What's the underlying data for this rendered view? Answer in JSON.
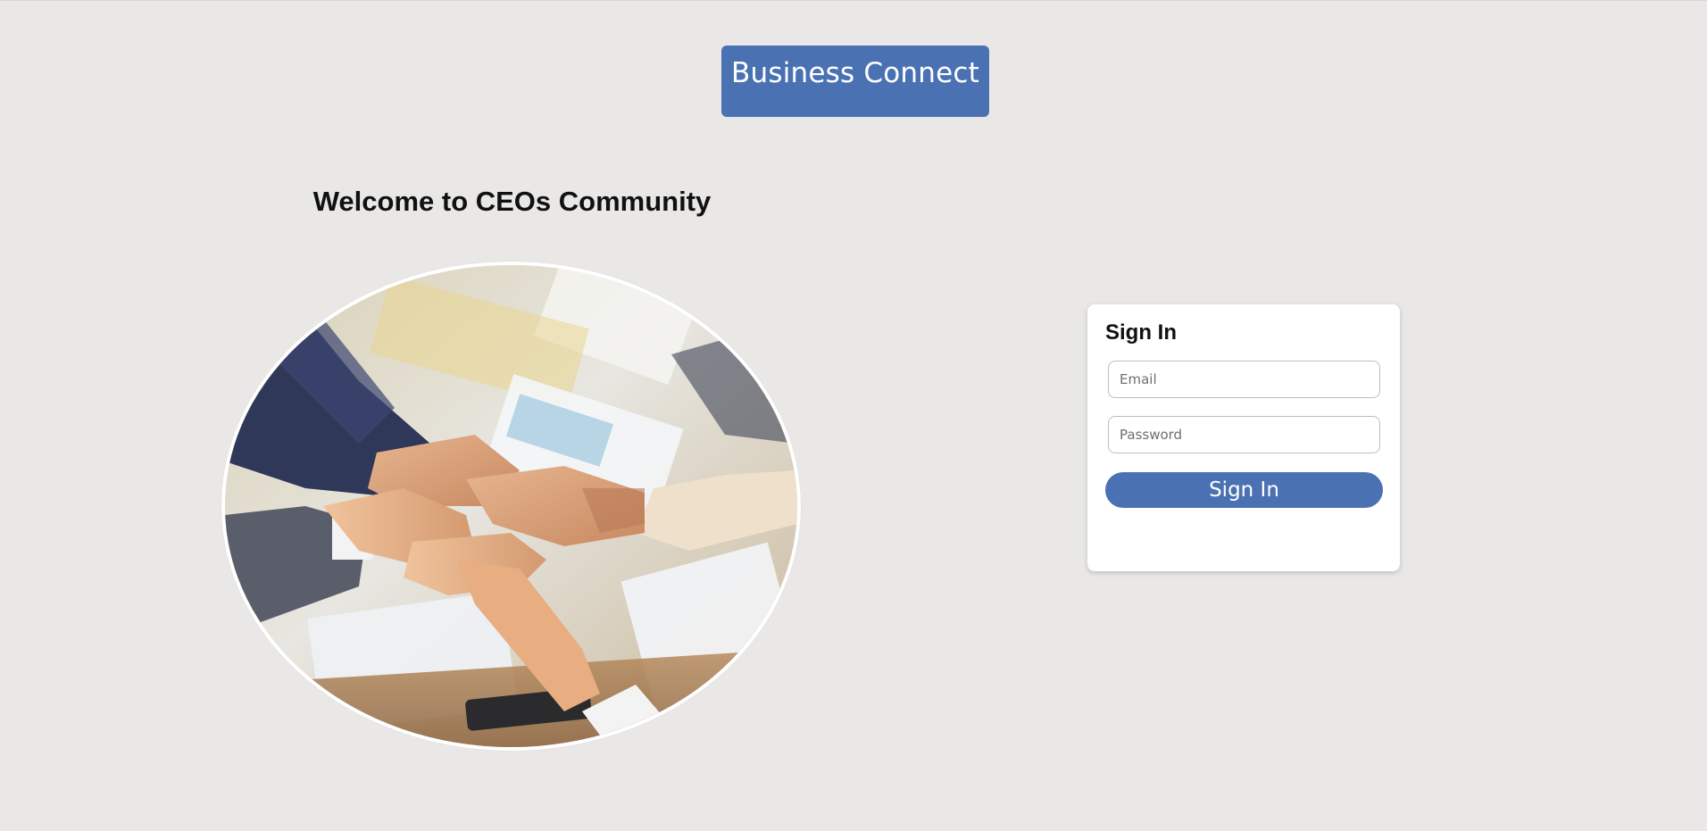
{
  "header": {
    "brand_label": "Business Connect",
    "brand_color": "#4a72b3"
  },
  "hero": {
    "heading": "Welcome to CEOs Community",
    "image_description_icon": "team-hands-stack-photo"
  },
  "signin": {
    "title": "Sign In",
    "email_placeholder": "Email",
    "email_value": "",
    "password_placeholder": "Password",
    "password_value": "",
    "button_label": "Sign In",
    "button_color": "#4a72b3"
  },
  "colors": {
    "background": "#e9e8e6",
    "card": "#ffffff",
    "heading_text": "#111111"
  }
}
